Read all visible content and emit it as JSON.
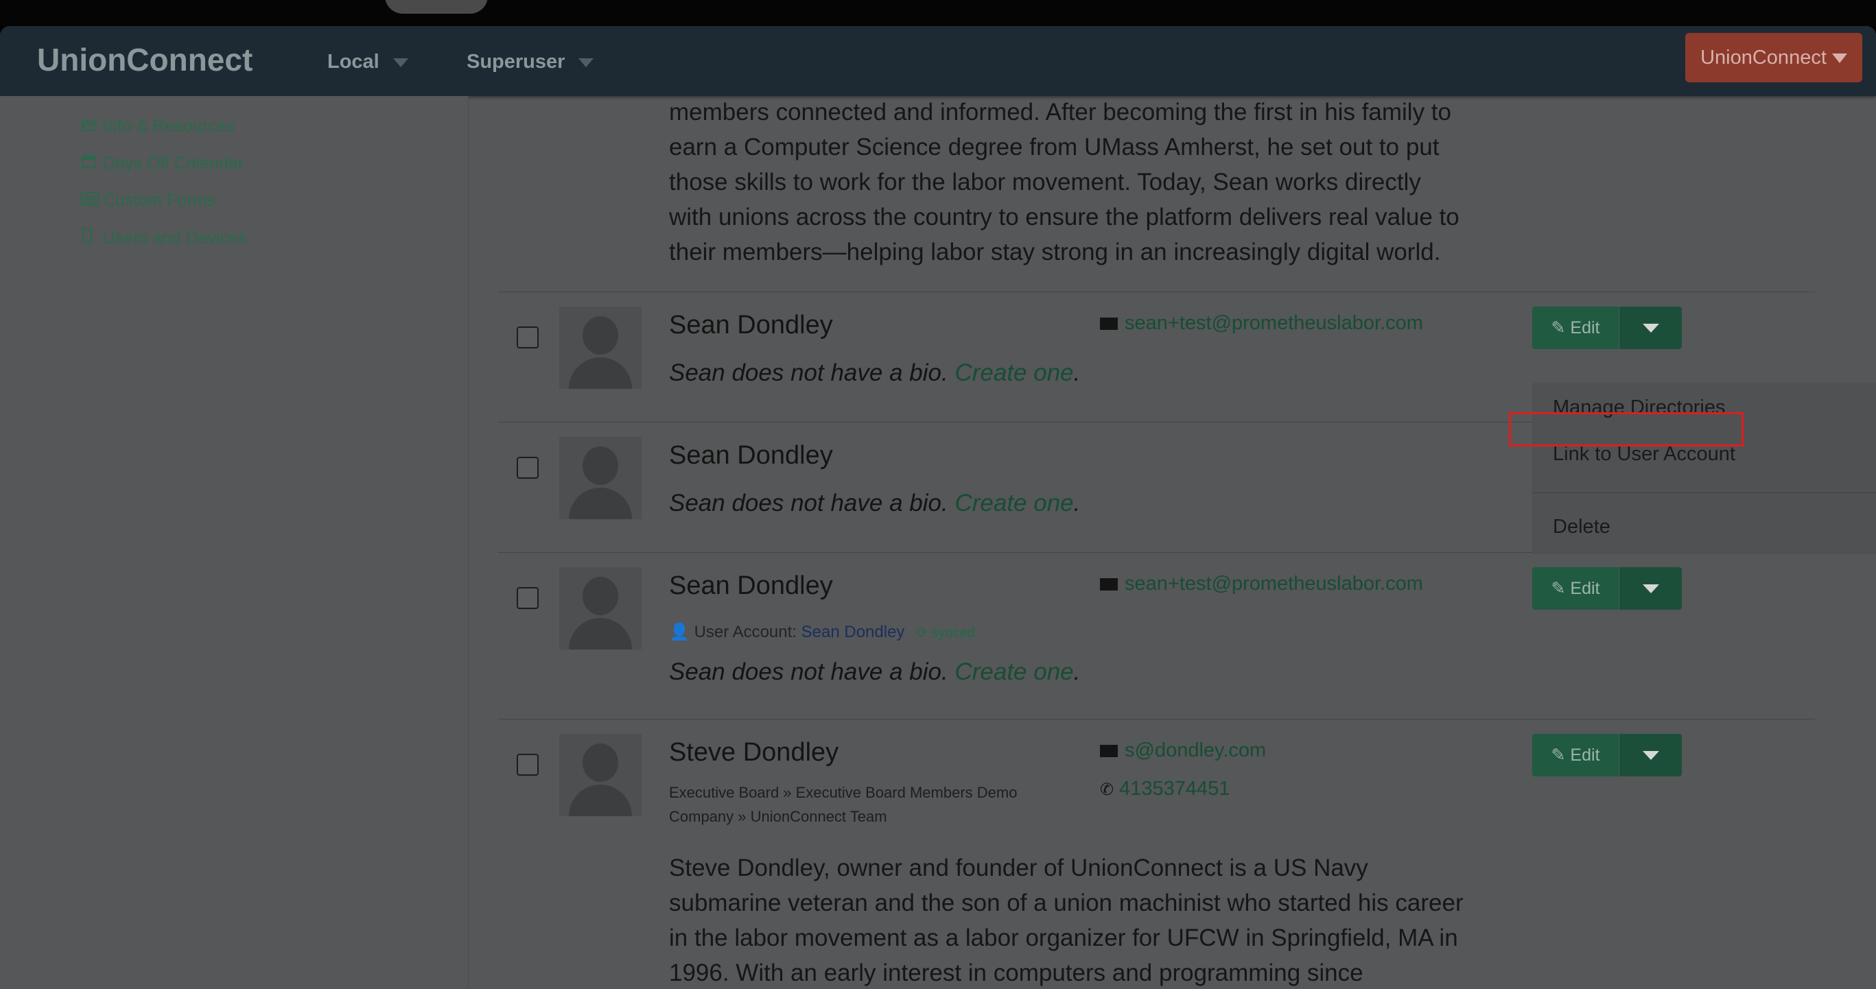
{
  "navbar": {
    "brand": "UnionConnect",
    "local_label": "Local",
    "superuser_label": "Superuser",
    "org_button_label": "UnionConnect"
  },
  "sidebar": {
    "items": [
      {
        "label": "Info & Resources",
        "icon": "folder-open-icon"
      },
      {
        "label": "Days Off Calendar",
        "icon": "calendar-icon"
      },
      {
        "label": "Custom Forms",
        "icon": "list-alt-icon"
      },
      {
        "label": "Users and Devices",
        "icon": "tablet-icon"
      }
    ]
  },
  "top_bio": {
    "lines": [
      "members connected and informed. After becoming the first in his family to",
      "earn a Computer Science degree from UMass Amherst, he set out to put",
      "those skills to work for the labor movement. Today, Sean works directly",
      "with unions across the country to ensure the platform delivers real value to",
      "their members—helping labor stay strong in an increasingly digital world."
    ]
  },
  "members": [
    {
      "name": "Sean Dondley",
      "email": "sean+test@prometheuslabor.com",
      "no_bio_text": "Sean does not have a bio.",
      "create_link": "Create one",
      "period": "."
    },
    {
      "name": "Sean Dondley",
      "no_bio_text": "Sean does not have a bio.",
      "create_link": "Create one",
      "period": "."
    },
    {
      "name": "Sean Dondley",
      "email": "sean+test@prometheuslabor.com",
      "user_account_label": "User Account:",
      "user_account_name": "Sean Dondley",
      "synced_label": "synced",
      "no_bio_text": "Sean does not have a bio.",
      "create_link": "Create one",
      "period": "."
    },
    {
      "name": "Steve Dondley",
      "email": "s@dondley.com",
      "phone": "4135374451",
      "breadcrumbs": "Executive Board » Executive Board Members   Demo Company » UnionConnect Team",
      "bio_lines": [
        "Steve Dondley, owner and founder of UnionConnect is a US Navy",
        "submarine veteran and the son of a union machinist who started his career",
        "in the labor movement as a labor organizer for UFCW in Springfield, MA in",
        "1996. With an early interest in computers and programming since"
      ]
    }
  ],
  "edit_label": "Edit",
  "dropdown_menu": {
    "items": [
      "Manage Directories",
      "Link to User Account",
      "Delete"
    ],
    "highlighted": "Link to User Account"
  },
  "colors": {
    "navbar_bg": "#1e2a33",
    "accent_green": "#1f5a41",
    "org_button": "#8c3a2c",
    "highlight_border": "#e01d1d"
  }
}
